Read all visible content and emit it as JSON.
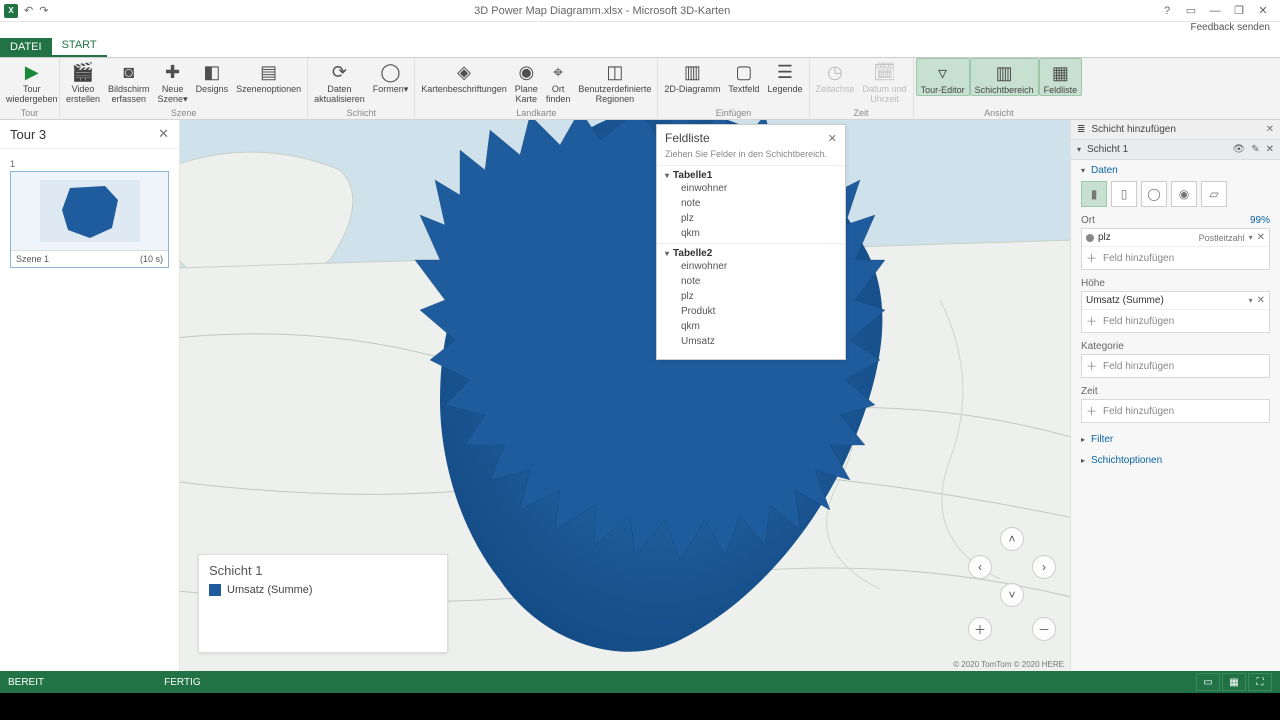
{
  "title": "3D Power Map Diagramm.xlsx - Microsoft 3D-Karten",
  "feedback": "Feedback senden",
  "tabs": {
    "file": "DATEI",
    "start": "START"
  },
  "ribbon": {
    "groups": {
      "tour": "Tour",
      "szene": "Szene",
      "schicht": "Schicht",
      "landkarte": "Landkarte",
      "einfuegen": "Einfügen",
      "zeit": "Zeit",
      "ansicht": "Ansicht"
    },
    "btns": {
      "tour_play": "Tour\nwiedergeben",
      "video": "Video\nerstellen",
      "screen": "Bildschirm\nerfassen",
      "new_scene": "Neue\nSzene▾",
      "designs": "Designs",
      "scene_opts": "Szenenoptionen",
      "refresh": "Daten\naktualisieren",
      "shapes": "Formen▾",
      "labels": "Kartenbeschriftungen",
      "flat": "Plane\nKarte",
      "find": "Ort\nfinden",
      "regions": "Benutzerdefinierte\nRegionen",
      "chart2d": "2D-Diagramm",
      "textfield": "Textfeld",
      "legend": "Legende",
      "timeline": "Zeitachse",
      "datetime": "Datum und\nUhrzeit",
      "toureditor": "Tour-Editor",
      "layerpane": "Schichtbereich",
      "fieldlist": "Feldliste"
    }
  },
  "tour": {
    "name": "Tour 3",
    "scene_num": "1",
    "scene_name": "Szene 1",
    "scene_dur": "(10 s)"
  },
  "map": {
    "legend_title": "Schicht 1",
    "legend_item": "Umsatz (Summe)",
    "attrib": "© 2020 TomTom © 2020 HERE"
  },
  "fieldlist": {
    "title": "Feldliste",
    "desc": "Ziehen Sie Felder in den Schichtbereich.",
    "tables": [
      {
        "name": "Tabelle1",
        "fields": [
          "einwohner",
          "note",
          "plz",
          "qkm"
        ]
      },
      {
        "name": "Tabelle2",
        "fields": [
          "einwohner",
          "note",
          "plz",
          "Produkt",
          "qkm",
          "Umsatz"
        ]
      }
    ]
  },
  "panel": {
    "add_layer": "Schicht hinzufügen",
    "layer": "Schicht 1",
    "data": "Daten",
    "ort": "Ort",
    "ort_pct": "99%",
    "ort_field": "plz",
    "ort_type": "Postleitzahl",
    "hoehe": "Höhe",
    "hoehe_field": "Umsatz (Summe)",
    "kategorie": "Kategorie",
    "zeit": "Zeit",
    "add_field": "Feld hinzufügen",
    "filter": "Filter",
    "options": "Schichtoptionen"
  },
  "status": {
    "ready": "BEREIT",
    "fertig": "FERTIG"
  }
}
